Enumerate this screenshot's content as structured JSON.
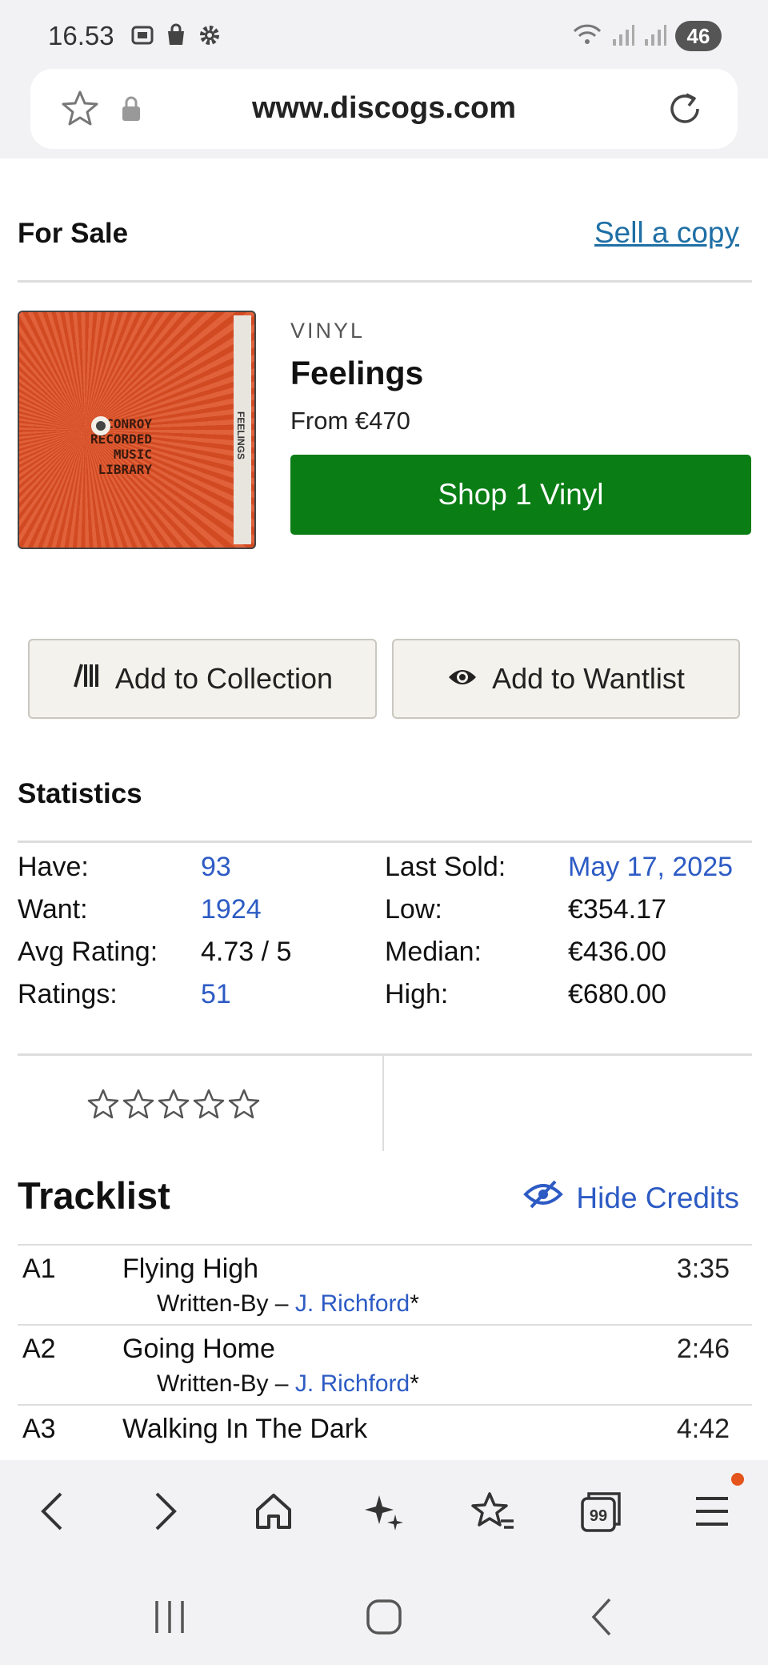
{
  "status_bar": {
    "time": "16.53",
    "battery": "46"
  },
  "browser": {
    "url": "www.discogs.com"
  },
  "for_sale": {
    "heading": "For Sale",
    "sell_link": "Sell a copy",
    "format": "VINYL",
    "title": "Feelings",
    "price": "From €470",
    "shop_button": "Shop 1 Vinyl",
    "cover": {
      "lines": [
        "CONROY",
        "RECORDED",
        "MUSIC",
        "LIBRARY"
      ],
      "spine_text": "FEELINGS"
    }
  },
  "actions": {
    "add_collection": "Add to Collection",
    "add_wantlist": "Add to Wantlist"
  },
  "statistics": {
    "heading": "Statistics",
    "rows": [
      {
        "label": "Have:",
        "value": "93",
        "label2": "Last Sold:",
        "value2": "May 17, 2025"
      },
      {
        "label": "Want:",
        "value": "1924",
        "label2": "Low:",
        "value2": "€354.17"
      },
      {
        "label": "Avg Rating:",
        "value": "4.73 / 5",
        "label2": "Median:",
        "value2": "€436.00"
      },
      {
        "label": "Ratings:",
        "value": "51",
        "label2": "High:",
        "value2": "€680.00"
      }
    ]
  },
  "rating": {
    "stars_filled": 0,
    "stars_total": 5
  },
  "tracklist": {
    "heading": "Tracklist",
    "hide_credits": "Hide Credits",
    "tracks": [
      {
        "position": "A1",
        "title": "Flying High",
        "duration": "3:35",
        "credit_role": "Written-By – ",
        "credit_name": "J. Richford",
        "credit_suffix": "*"
      },
      {
        "position": "A2",
        "title": "Going Home",
        "duration": "2:46",
        "credit_role": "Written-By – ",
        "credit_name": "J. Richford",
        "credit_suffix": "*"
      },
      {
        "position": "A3",
        "title": "Walking In The Dark",
        "duration": "4:42"
      }
    ]
  },
  "colors": {
    "accent_green": "#0a7d15",
    "link_blue": "#2d5bc4",
    "sell_link": "#1f6fa5",
    "cover_orange": "#d9532a"
  }
}
